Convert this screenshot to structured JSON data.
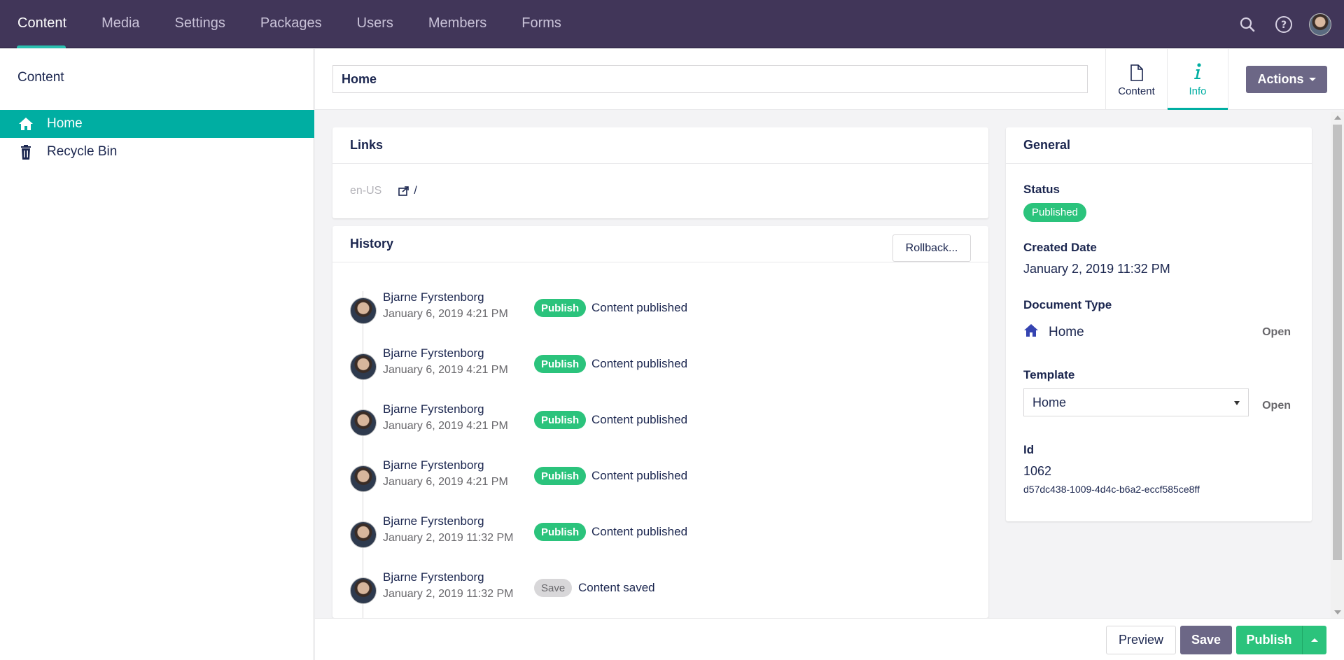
{
  "nav": {
    "sections": [
      "Content",
      "Media",
      "Settings",
      "Packages",
      "Users",
      "Members",
      "Forms"
    ],
    "active": "Content",
    "icons": [
      "search-icon",
      "help-icon",
      "user-avatar"
    ]
  },
  "tree": {
    "title": "Content",
    "items": [
      {
        "label": "Home",
        "icon": "home-icon",
        "selected": true
      },
      {
        "label": "Recycle Bin",
        "icon": "trash-icon",
        "selected": false
      }
    ]
  },
  "editor": {
    "name_value": "Home",
    "apps": [
      {
        "label": "Content",
        "icon": "document-icon"
      },
      {
        "label": "Info",
        "icon": "info-icon",
        "active": true
      }
    ],
    "actions_label": "Actions"
  },
  "links": {
    "title": "Links",
    "culture": "en-US",
    "url": "/"
  },
  "history": {
    "title": "History",
    "rollback_label": "Rollback...",
    "entries": [
      {
        "user": "Bjarne Fyrstenborg",
        "date": "January 6, 2019 4:21 PM",
        "badge": "Publish",
        "message": "Content published"
      },
      {
        "user": "Bjarne Fyrstenborg",
        "date": "January 6, 2019 4:21 PM",
        "badge": "Publish",
        "message": "Content published"
      },
      {
        "user": "Bjarne Fyrstenborg",
        "date": "January 6, 2019 4:21 PM",
        "badge": "Publish",
        "message": "Content published"
      },
      {
        "user": "Bjarne Fyrstenborg",
        "date": "January 6, 2019 4:21 PM",
        "badge": "Publish",
        "message": "Content published"
      },
      {
        "user": "Bjarne Fyrstenborg",
        "date": "January 2, 2019 11:32 PM",
        "badge": "Publish",
        "message": "Content published"
      },
      {
        "user": "Bjarne Fyrstenborg",
        "date": "January 2, 2019 11:32 PM",
        "badge": "Save",
        "message": "Content saved"
      }
    ]
  },
  "general": {
    "title": "General",
    "status_label": "Status",
    "status_value": "Published",
    "created_label": "Created Date",
    "created_value": "January 2, 2019 11:32 PM",
    "doctype_label": "Document Type",
    "doctype_value": "Home",
    "open_label": "Open",
    "template_label": "Template",
    "template_value": "Home",
    "id_label": "Id",
    "id_value": "1062",
    "guid_value": "d57dc438-1009-4d4c-b6a2-eccf585ce8ff"
  },
  "footer": {
    "preview_label": "Preview",
    "save_label": "Save",
    "publish_label": "Publish"
  },
  "colors": {
    "topbar": "#413659",
    "accent": "#00aea2",
    "publish": "#2bc37c",
    "secondary_button": "#6c6786"
  }
}
